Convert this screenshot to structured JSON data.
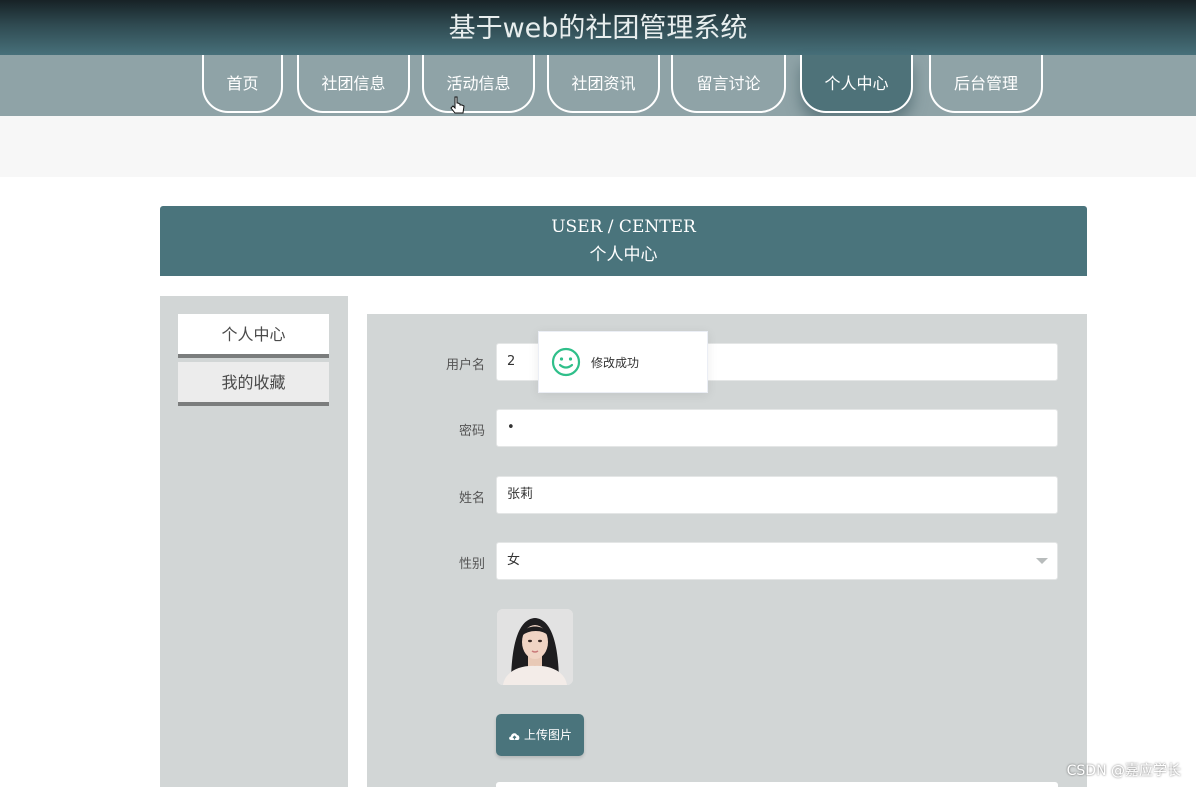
{
  "header": {
    "title": "基于web的社团管理系统"
  },
  "nav": {
    "items": [
      {
        "label": "首页"
      },
      {
        "label": "社团信息"
      },
      {
        "label": "活动信息"
      },
      {
        "label": "社团资讯"
      },
      {
        "label": "留言讨论"
      },
      {
        "label": "个人中心",
        "active": true
      },
      {
        "label": "后台管理"
      }
    ]
  },
  "section": {
    "title_en": "USER / CENTER",
    "title_cn": "个人中心"
  },
  "sidebar": {
    "items": [
      {
        "label": "个人中心",
        "active": true
      },
      {
        "label": "我的收藏"
      }
    ]
  },
  "form": {
    "username": {
      "label": "用户名",
      "value": "2"
    },
    "password": {
      "label": "密码",
      "value": "•"
    },
    "name": {
      "label": "姓名",
      "value": "张莉"
    },
    "gender": {
      "label": "性别",
      "value": "女"
    },
    "upload_label": "上传图片"
  },
  "toast": {
    "message": "修改成功"
  },
  "watermark": "CSDN @嘉应学长",
  "colors": {
    "accent": "#4a747c",
    "nav_bg": "#8fa3a7",
    "panel_bg": "#d2d6d6",
    "toast_icon": "#2fbf8a"
  }
}
